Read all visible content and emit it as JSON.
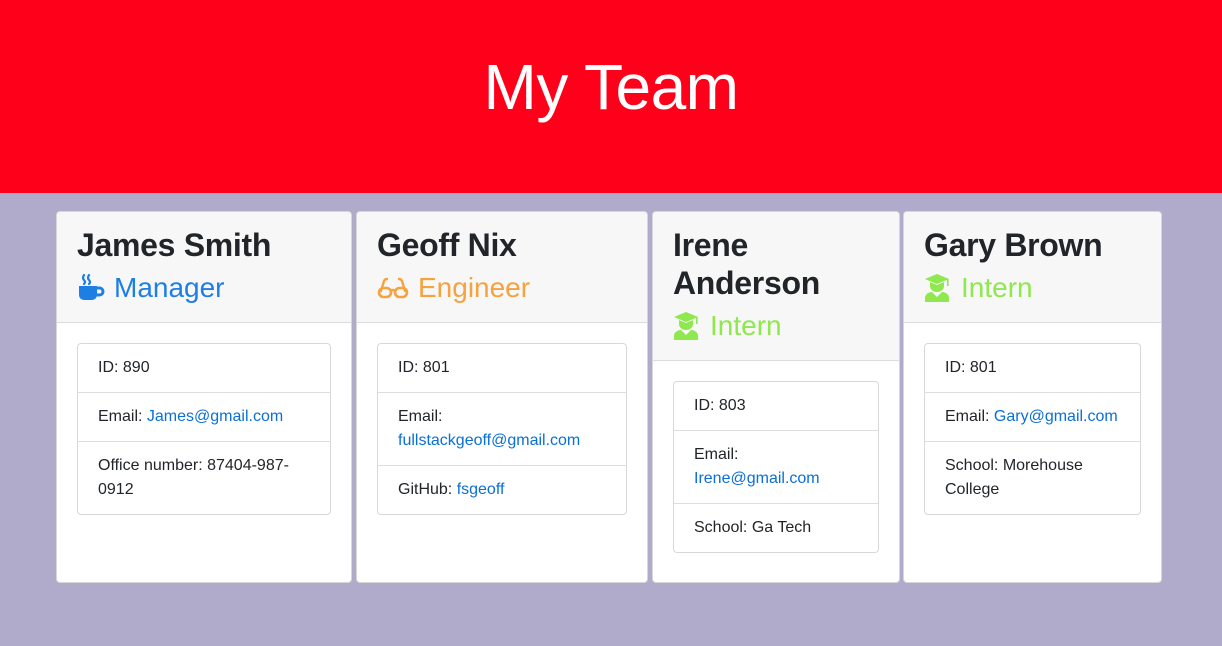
{
  "header": {
    "title": "My Team"
  },
  "colors": {
    "manager": "#1d7fe3",
    "engineer": "#f6a23e",
    "intern": "#8ee84e"
  },
  "cards": [
    {
      "name": "James Smith",
      "role": "Manager",
      "role_icon": "coffee-mug-icon",
      "id_text": "ID: 890",
      "email_label": "Email: ",
      "email": "James@gmail.com",
      "extra_label": "Office number: ",
      "extra_value": "87404-987-0912"
    },
    {
      "name": "Geoff Nix",
      "role": "Engineer",
      "role_icon": "glasses-icon",
      "id_text": "ID: 801",
      "email_label": "Email: ",
      "email": "fullstackgeoff@gmail.com",
      "extra_label": "GitHub: ",
      "extra_value": "fsgeoff"
    },
    {
      "name": "Irene Anderson",
      "role": "Intern",
      "role_icon": "graduate-icon",
      "id_text": "ID: 803",
      "email_label": "Email: ",
      "email": "Irene@gmail.com",
      "extra_label": "School: ",
      "extra_value": "Ga Tech"
    },
    {
      "name": "Gary Brown",
      "role": "Intern",
      "role_icon": "graduate-icon",
      "id_text": "ID: 801",
      "email_label": "Email: ",
      "email": "Gary@gmail.com",
      "extra_label": "School: ",
      "extra_value": "Morehouse College"
    }
  ]
}
